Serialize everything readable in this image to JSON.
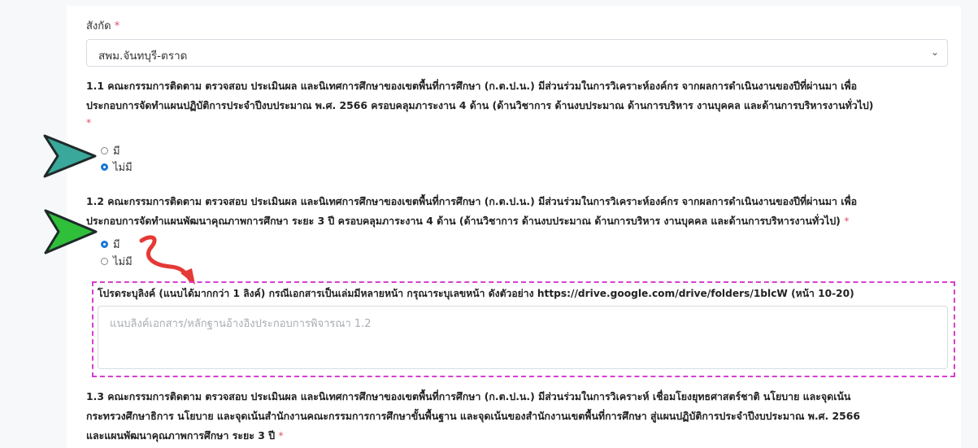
{
  "form": {
    "affiliation": {
      "label": "สังกัด",
      "required_mark": "*",
      "selected": "สพม.จันทบุรี-ตราด"
    },
    "q1_1": {
      "line1": "1.1 คณะกรรมการติดตาม ตรวจสอบ ประเมินผล และนิเทศการศึกษาของเขตพื้นที่การศึกษา (ก.ต.ป.น.) มีส่วนร่วมในการวิเคราะห์องค์กร จากผลการดำเนินงานของปีที่ผ่านมา เพื่อ",
      "line2": "ประกอบการจัดทำแผนปฏิบัติการประจำปีงบประมาณ พ.ศ. 2566 ครอบคลุมภาระงาน 4 ด้าน (ด้านวิชาการ ด้านงบประมาณ ด้านการบริหาร งานบุคคล และด้านการบริหารงานทั่วไป)",
      "required_mark": "*",
      "options": [
        "มี",
        "ไม่มี"
      ],
      "selected_index": 1
    },
    "q1_2": {
      "line1": "1.2 คณะกรรมการติดตาม ตรวจสอบ ประเมินผล และนิเทศการศึกษาของเขตพื้นที่การศึกษา (ก.ต.ป.น.) มีส่วนร่วมในการวิเคราะห์องค์กร จากผลการดำเนินงานของปีที่ผ่านมา เพื่อ",
      "line2": "ประกอบการจัดทำแผนพัฒนาคุณภาพการศึกษา ระยะ 3 ปี ครอบคลุมภาระงาน 4 ด้าน (ด้านวิชาการ ด้านงบประมาณ ด้านการบริหาร งานบุคคล และด้านการบริหารงานทั่วไป)",
      "required_mark": "*",
      "options": [
        "มี",
        "ไม่มี"
      ],
      "selected_index": 0
    },
    "link_field": {
      "label": "โปรดระบุลิงค์ (แนบได้มากกว่า 1 ลิงค์) กรณีเอกสารเป็นเล่มมีหลายหน้า กรุณาระบุเลขหน้า ดังตัวอย่าง https://drive.google.com/drive/folders/1blcW (หน้า 10-20)",
      "placeholder": "แนบลิงค์เอกสาร/หลักฐานอ้างอิงประกอบการพิจารณา 1.2"
    },
    "q1_3": {
      "line1": "1.3 คณะกรรมการติดตาม ตรวจสอบ ประเมินผล และนิเทศการศึกษาของเขตพื้นที่การศึกษา (ก.ต.ป.น.) มีส่วนร่วมในการวิเคราะห์ เชื่อมโยงยุทธศาสตร์ชาติ นโยบาย และจุดเน้น",
      "line2": "กระทรวงศึกษาธิการ นโยบาย และจุดเน้นสำนักงานคณะกรรมการการศึกษาขั้นพื้นฐาน และจุดเน้นของสำนักงานเขตพื้นที่การศึกษา สู่แผนปฏิบัติการประจำปีงบประมาณ พ.ศ. 2566",
      "line3": "และแผนพัฒนาคุณภาพการศึกษา ระยะ 3 ปี",
      "required_mark": "*"
    }
  },
  "colors": {
    "accent": "#1976d2",
    "required": "#e0506a",
    "annotation_box": "#d63fd0",
    "annotation_arrow": "#e53935",
    "pointer_teal": "#3aa89a",
    "pointer_green": "#2fbf3a"
  }
}
